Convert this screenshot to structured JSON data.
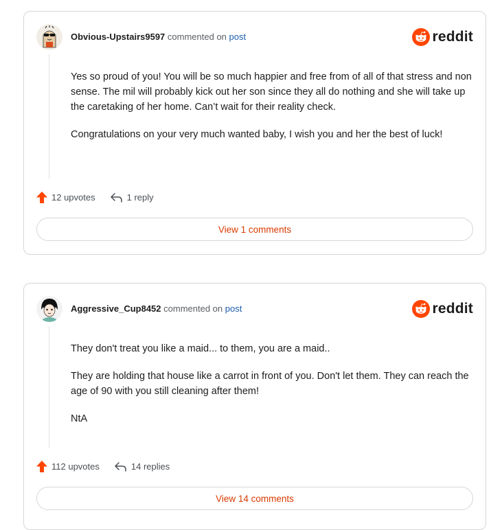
{
  "comments": [
    {
      "author": "Obvious-Upstairs9597",
      "commented_on": "commented on",
      "post_link": "post",
      "brand": "reddit",
      "paragraphs": [
        "Yes so proud of you! You will be so much happier and free from of all of that stress and non sense. The mil will probably kick out her son since they all do nothing and she will take up the caretaking of her home. Can’t wait for their reality check.",
        "Congratulations on your very much wanted baby, I wish you and her the best of luck!"
      ],
      "upvotes": "12 upvotes",
      "replies": "1 reply",
      "view_button": "View 1 comments"
    },
    {
      "author": "Aggressive_Cup8452",
      "commented_on": "commented on",
      "post_link": "post",
      "brand": "reddit",
      "paragraphs": [
        "They don't treat you like a maid... to them, you are a maid..",
        "They are holding that house like a carrot in front of you. Don't let them. They can reach the age of 90 with you still cleaning after them!",
        "NtA"
      ],
      "upvotes": "112 upvotes",
      "replies": "14 replies",
      "view_button": "View 14 comments"
    }
  ],
  "icons": {
    "upvote": "upvote-arrow-icon",
    "reply": "reply-arrow-icon",
    "brand": "reddit-snoo-icon"
  },
  "colors": {
    "accent": "#d93a00",
    "upvote": "#ff4500",
    "link": "#1b5db2",
    "border": "#d6d6d6"
  }
}
